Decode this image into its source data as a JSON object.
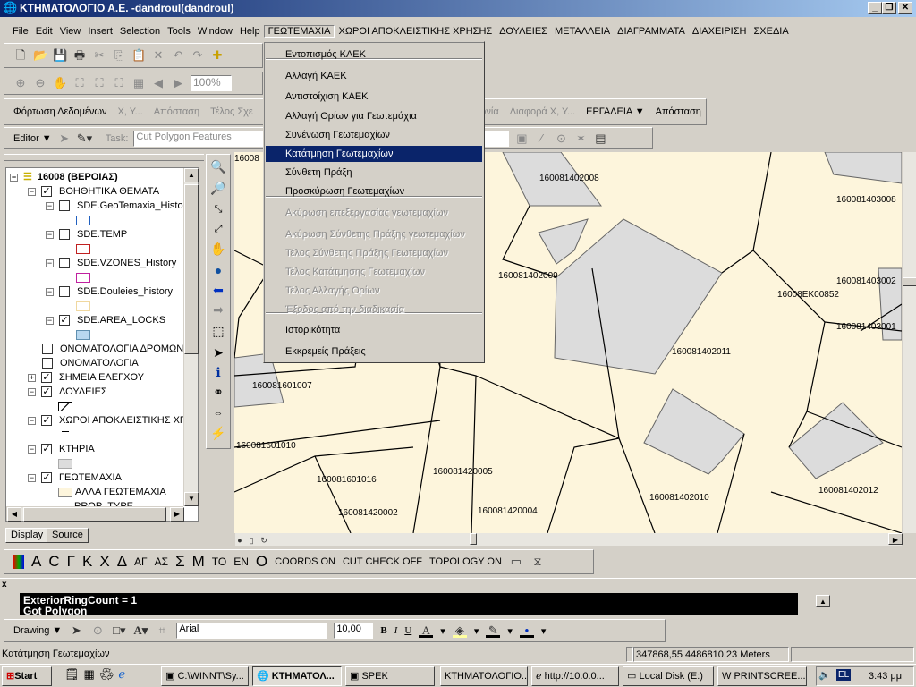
{
  "window": {
    "title": "ΚΤΗΜΑΤΟΛΟΓΙΟ Α.Ε. -dandroul(dandroul)",
    "minimize": "_",
    "restore": "❐",
    "close": "✕"
  },
  "menubar": [
    "File",
    "Edit",
    "View",
    "Insert",
    "Selection",
    "Tools",
    "Window",
    "Help",
    "ΓΕΩΤΕΜΑΧΙΑ",
    "ΧΩΡΟΙ ΑΠΟΚΛΕΙΣΤΙΚΗΣ ΧΡΗΣΗΣ",
    "ΔΟΥΛΕΙΕΣ",
    "ΜΕΤΑΛΛΕΙΑ",
    "ΔΙΑΓΡΑΜΜΑΤΑ",
    "ΔΙΑΧΕΙΡΙΣΗ",
    "ΣΧΕΔΙΑ"
  ],
  "dropdown": {
    "items": [
      {
        "label": "Εντοπισμός ΚΑΕΚ",
        "enabled": true
      },
      {
        "label": "Αλλαγή ΚΑΕΚ",
        "enabled": true
      },
      {
        "label": "Αντιστοίχιση ΚΑΕΚ",
        "enabled": true
      },
      {
        "label": "Αλλαγή Ορίων για Γεωτεμάχια",
        "enabled": true
      },
      {
        "label": "Συνένωση Γεωτεμαχίων",
        "enabled": true
      },
      {
        "label": "Κατάτμηση Γεωτεμαχίων",
        "enabled": true,
        "highlighted": true
      },
      {
        "label": "Σύνθετη Πράξη",
        "enabled": true
      },
      {
        "label": "Προσκύρωση Γεωτεμαχίων",
        "enabled": true
      },
      {
        "label": "Ακύρωση επεξεργασίας γεωτεμαχίων",
        "enabled": false
      },
      {
        "label": "Ακύρωση Σύνθετης Πράξης γεωτεμαχίων",
        "enabled": false
      },
      {
        "label": "Τέλος Σύνθετης Πράξης Γεωτεμαχίων",
        "enabled": false
      },
      {
        "label": "Τέλος Κατάτμησης Γεωτεμαχίων",
        "enabled": false
      },
      {
        "label": "Τέλος Αλλαγής Ορίων",
        "enabled": false
      },
      {
        "label": "Έξοδος από την διαδικασία",
        "enabled": false
      },
      {
        "label": "Ιστορικότητα",
        "enabled": true
      },
      {
        "label": "Εκκρεμείς Πράξεις",
        "enabled": true
      }
    ]
  },
  "toolbar": {
    "zoom_value": "100%"
  },
  "custom_toolbar": {
    "load": "Φόρτωση Δεδομένων",
    "xy": "X, Y...",
    "distance": "Απόσταση",
    "end": "Τέλος Σχε",
    "angle": "ωνία",
    "diff": "Διαφορά X, Y...",
    "tools": "ΕΡΓΑΛΕΙΑ",
    "distance2": "Απόσταση"
  },
  "editor": {
    "label": "Editor",
    "task_label": "Task:",
    "task_value": "Cut Polygon Features"
  },
  "toc": {
    "root": "16008 (ΒΕΡΟΙΑΣ)",
    "rows": [
      {
        "label": "ΒΟΗΘΗΤΙΚΑ ΘΕΜΑΤΑ",
        "checked": true,
        "expand": "-",
        "level": 1
      },
      {
        "label": "SDE.GeoTemaxia_History",
        "checked": false,
        "expand": "-",
        "level": 2,
        "swatch": "#2060c0"
      },
      {
        "label": "SDE.TEMP",
        "checked": false,
        "expand": "-",
        "level": 2,
        "swatch": "#c02020"
      },
      {
        "label": "SDE.VZONES_History",
        "checked": false,
        "expand": "-",
        "level": 2,
        "swatch": "#c020a0"
      },
      {
        "label": "SDE.Douleies_history",
        "checked": false,
        "expand": "-",
        "level": 2,
        "swatch": "#f0d8a0"
      },
      {
        "label": "SDE.AREA_LOCKS",
        "checked": true,
        "expand": "-",
        "level": 2,
        "swatch": "#b8d8f0"
      },
      {
        "label": "ΟΝΟΜΑΤΟΛΟΓΙΑ ΔΡΟΜΩΝ",
        "checked": false,
        "level": 1
      },
      {
        "label": "ΟΝΟΜΑΤΟΛΟΓΙΑ",
        "checked": false,
        "level": 1
      },
      {
        "label": "ΣΗΜΕΙΑ ΕΛΕΓΧΟΥ",
        "checked": true,
        "expand": "+",
        "level": 1
      },
      {
        "label": "ΔΟΥΛΕΙΕΣ",
        "checked": true,
        "expand": "-",
        "level": 1
      },
      {
        "label": "ΧΩΡΟΙ ΑΠΟΚΛΕΙΣΤΙΚΗΣ ΧΡΗΣ",
        "checked": true,
        "expand": "-",
        "level": 1
      },
      {
        "label": "ΚΤΗΡΙΑ",
        "checked": true,
        "expand": "-",
        "level": 1
      },
      {
        "label": "ΓΕΩΤΕΜΑΧΙΑ",
        "checked": true,
        "expand": "-",
        "level": 1
      }
    ],
    "other_parcels": "ΑΛΛΑ ΓΕΩΤΕΜΑΧΙΑ",
    "prop_type": "PROP_TYPE",
    "tabs": [
      "Display",
      "Source"
    ]
  },
  "map": {
    "labels": [
      "16008",
      "160081402008",
      "160081403008",
      "160081402009",
      "16008EK00852",
      "160081403002",
      "160081403001",
      "160081402011",
      "160081601007",
      "160081601010",
      "160081420005",
      "160081601016",
      "160081402010",
      "160081402012",
      "160081420002",
      "160081420004"
    ],
    "colors": {
      "background": "#fdf5dc",
      "building": "#dcdcdc",
      "line": "#000000"
    }
  },
  "custom_toolbar2": {
    "letters": [
      "Α",
      "C",
      "Γ",
      "Κ",
      "Χ",
      "Δ",
      "ΑΓ",
      "ΑΣ",
      "Σ",
      "Μ",
      "ΤΟ",
      "ΕΝ",
      "Ο"
    ],
    "coords": "COORDS ON",
    "cutcheck": "CUT CHECK OFF",
    "topology": "TOPOLOGY ON"
  },
  "command": {
    "close": "x",
    "lines": [
      "ExteriorRingCount = 1",
      "Got Polygon"
    ]
  },
  "drawing": {
    "label": "Drawing",
    "font": "Arial",
    "size": "10,00",
    "bold": "B",
    "italic": "I",
    "underline": "U"
  },
  "status": {
    "message": "Κατάτμηση Γεωτεμαχίων",
    "coords": "347868,55  4486810,23 Meters"
  },
  "taskbar": {
    "start": "Start",
    "tasks": [
      "C:\\WINNT\\Sy...",
      "ΚΤΗΜΑΤΟΛ...",
      "SPEK",
      "ΚΤΗΜΑΤΟΛΟΓΙΟ...",
      "http://10.0.0...",
      "Local Disk (E:)",
      "PRINTSCREE..."
    ],
    "lang": "EL",
    "clock": "3:43 μμ"
  }
}
